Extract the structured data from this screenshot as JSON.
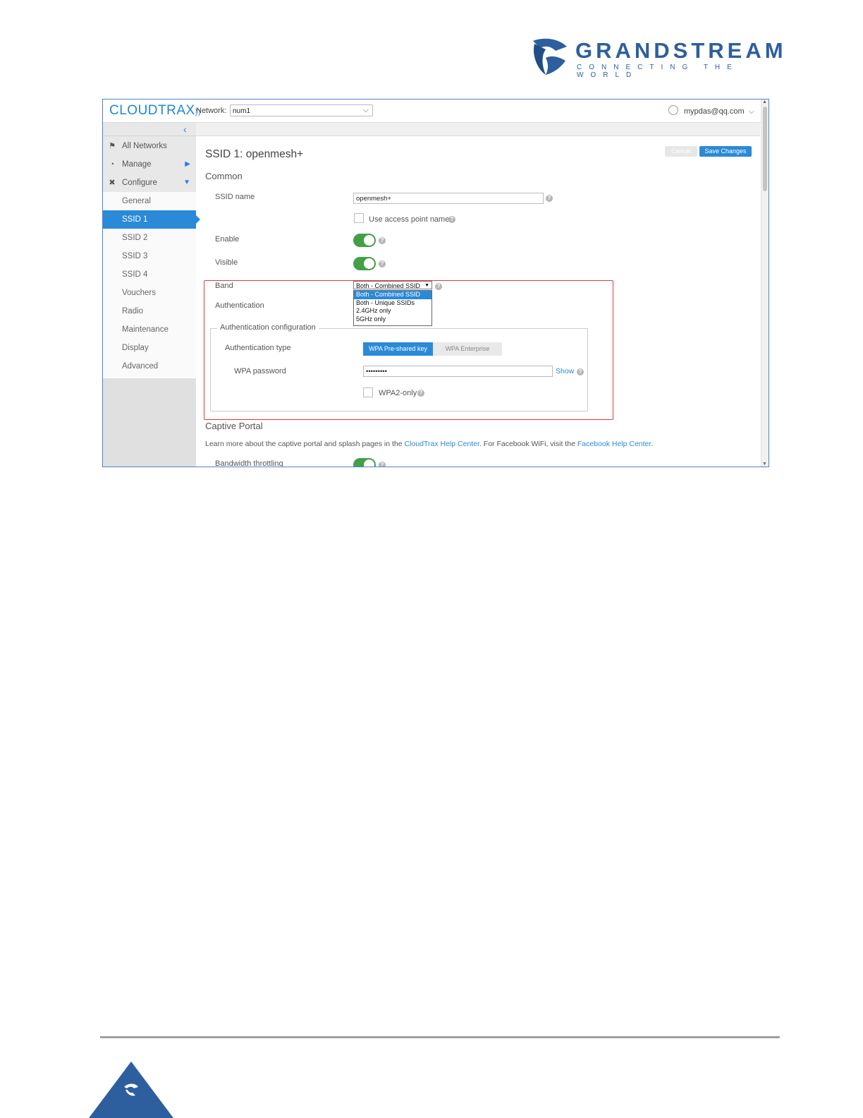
{
  "header_logo": {
    "name": "GRANDSTREAM",
    "tagline": "CONNECTING THE WORLD"
  },
  "app": {
    "brand": "CLOUDTRAX",
    "network_label": "Network:",
    "network_value": "num1",
    "user_email": "mypdas@qq.com"
  },
  "sidebar": {
    "items": [
      {
        "label": "All Networks",
        "icon": "pin-icon"
      },
      {
        "label": "Manage",
        "icon": "gauge-icon"
      },
      {
        "label": "Configure",
        "icon": "tools-icon"
      }
    ],
    "subitems": [
      "General",
      "SSID 1",
      "SSID 2",
      "SSID 3",
      "SSID 4",
      "Vouchers",
      "Radio",
      "Maintenance",
      "Display",
      "Advanced"
    ],
    "active": "SSID 1"
  },
  "page": {
    "title": "SSID 1: openmesh+",
    "cancel_label": "Cancel",
    "save_label": "Save Changes",
    "section_common": "Common",
    "ssid_name_label": "SSID name",
    "ssid_name_value": "openmesh+",
    "use_ap_name_label": "Use access point name",
    "enable_label": "Enable",
    "visible_label": "Visible",
    "band_label": "Band",
    "band_selected": "Both - Combined SSID",
    "band_options": [
      "Both - Combined SSID",
      "Both - Unique SSIDs",
      "2.4GHz only",
      "5GHz only"
    ],
    "authentication_label": "Authentication",
    "auth_config_legend": "Authentication configuration",
    "auth_type_label": "Authentication type",
    "auth_type_options": [
      "WPA Pre-shared key",
      "WPA Enterprise"
    ],
    "auth_type_selected": "WPA Pre-shared key",
    "wpa_password_label": "WPA password",
    "wpa_password_value": "•••••••••",
    "show_link": "Show",
    "wpa2_only_label": "WPA2-only",
    "section_captive": "Captive Portal",
    "captive_text_1": "Learn more about the captive portal and splash pages in the ",
    "captive_link_1": "CloudTrax Help Center",
    "captive_text_2": ". For Facebook WiFi, visit the ",
    "captive_link_2": "Facebook Help Center",
    "captive_text_3": ".",
    "bandwidth_label": "Bandwidth throttling"
  },
  "colors": {
    "accent": "#2a8ad8",
    "toggle_on": "#43a047",
    "highlight_box": "#e53935",
    "brand": "#2d5f9e"
  }
}
